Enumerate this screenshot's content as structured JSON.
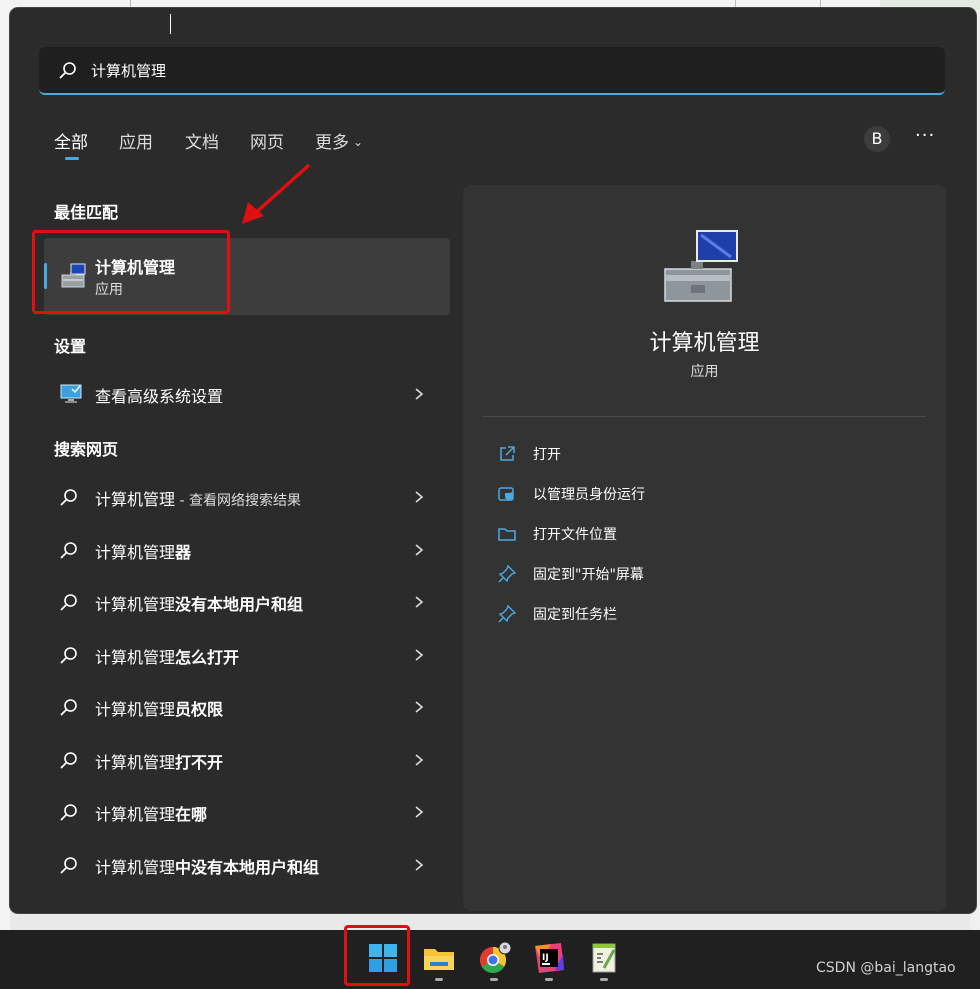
{
  "search": {
    "value": "计算机管理",
    "placeholder": ""
  },
  "tabs": [
    {
      "label": "全部"
    },
    {
      "label": "应用"
    },
    {
      "label": "文档"
    },
    {
      "label": "网页"
    },
    {
      "label": "更多"
    }
  ],
  "account": {
    "initial": "B"
  },
  "more_menu_label": "···",
  "sections": {
    "best_match": "最佳匹配",
    "settings": "设置",
    "web": "搜索网页"
  },
  "best_match": {
    "title": "计算机管理",
    "type": "应用"
  },
  "settings_items": [
    {
      "label": "查看高级系统设置"
    }
  ],
  "web_results": [
    {
      "prefix": "计算机管理",
      "bold": "",
      "hint": " - 查看网络搜索结果"
    },
    {
      "prefix": "计算机管理",
      "bold": "器",
      "hint": ""
    },
    {
      "prefix": "计算机管理",
      "bold": "没有本地用户和组",
      "hint": ""
    },
    {
      "prefix": "计算机管理",
      "bold": "怎么打开",
      "hint": ""
    },
    {
      "prefix": "计算机管理",
      "bold": "员权限",
      "hint": ""
    },
    {
      "prefix": "计算机管理",
      "bold": "打不开",
      "hint": ""
    },
    {
      "prefix": "计算机管理",
      "bold": "在哪",
      "hint": ""
    },
    {
      "prefix": "计算机管理",
      "bold": "中没有本地用户和组",
      "hint": ""
    }
  ],
  "detail": {
    "title": "计算机管理",
    "type": "应用",
    "actions": [
      {
        "label": "打开",
        "icon": "open-external-icon"
      },
      {
        "label": "以管理员身份运行",
        "icon": "shield-admin-icon"
      },
      {
        "label": "打开文件位置",
        "icon": "folder-icon"
      },
      {
        "label": "固定到\"开始\"屏幕",
        "icon": "pin-icon"
      },
      {
        "label": "固定到任务栏",
        "icon": "pin-icon"
      }
    ]
  },
  "taskbar": {
    "apps": [
      "windows-start-icon",
      "file-explorer-icon",
      "chrome-icon",
      "intellij-icon",
      "notepadpp-icon"
    ]
  },
  "watermark": "CSDN @bai_langtao",
  "colors": {
    "accent": "#4ea8de",
    "highlight": "#e01010",
    "panel": "#2b2b2b"
  }
}
